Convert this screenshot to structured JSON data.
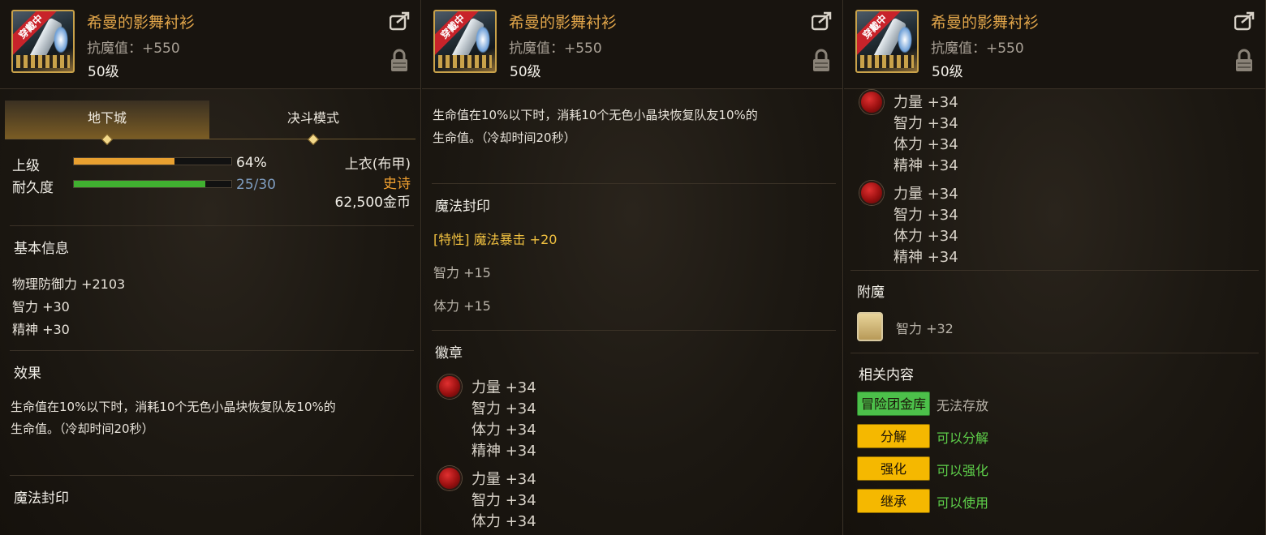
{
  "item": {
    "name": "希曼的影舞衬衫",
    "stat": "抗魔值：+550",
    "level": "50级",
    "ribbon": "穿戴中"
  },
  "tabs": [
    "地下城",
    "决斗模式"
  ],
  "grade": {
    "label": "上级",
    "value": "64%",
    "fraction": 0.64
  },
  "durability": {
    "label": "耐久度",
    "value": "25/30",
    "fraction": 0.833
  },
  "slot": {
    "type": "上衣(布甲)",
    "rarity": "史诗",
    "price": "62,500金币"
  },
  "basic_info": {
    "title": "基本信息",
    "lines": [
      "物理防御力 +2103",
      "智力 +30",
      "精神 +30"
    ]
  },
  "effect": {
    "title": "效果",
    "lines": [
      "生命值在10%以下时，消耗10个无色小晶块恢复队友10%的",
      "生命值。（冷却时间20秒）"
    ]
  },
  "magic_seal": {
    "title": "魔法封印",
    "trait": "[特性] 魔法暴击 +20",
    "lines": [
      "智力 +15",
      "体力 +15"
    ]
  },
  "emblem": {
    "title": "徽章",
    "groups": [
      [
        "力量 +34",
        "智力 +34",
        "体力 +34",
        "精神 +34"
      ],
      [
        "力量 +34",
        "智力 +34",
        "体力 +34",
        "精神 +34"
      ]
    ],
    "partial": "体力 +34"
  },
  "enchant": {
    "title": "附魔",
    "value": "智力 +32"
  },
  "related": {
    "title": "相关内容",
    "items": [
      {
        "button": "冒险团金库",
        "status": "无法存放"
      },
      {
        "button": "分解",
        "status": "可以分解"
      },
      {
        "button": "强化",
        "status": "可以强化"
      },
      {
        "button": "继承",
        "status": "可以使用"
      }
    ]
  },
  "colors": {
    "item_name": "#e2a64a",
    "rarity": "#f0a030",
    "grade_bar": "#e8a030",
    "durability_bar": "#40b030",
    "status_green": "#5ed04a"
  },
  "icons": [
    "share-icon",
    "lock-icon",
    "emblem-orb-icon",
    "enchant-card-icon"
  ]
}
